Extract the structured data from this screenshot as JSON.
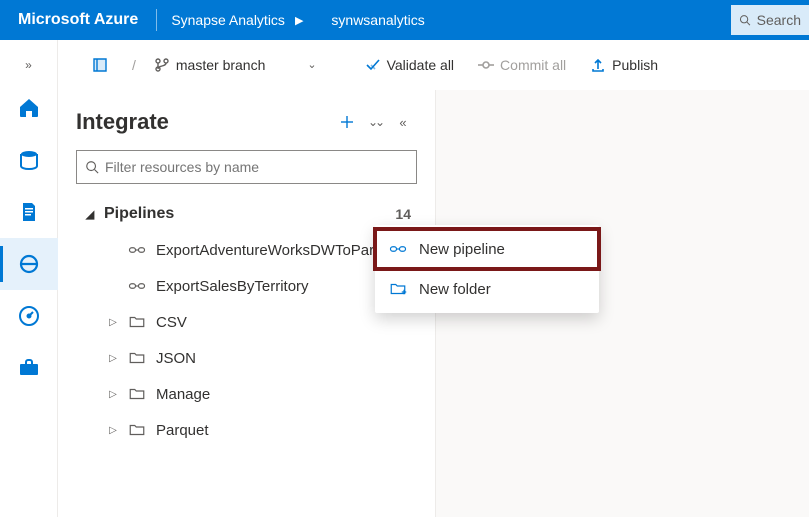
{
  "header": {
    "brand": "Microsoft Azure",
    "service": "Synapse Analytics",
    "workspace": "synwsanalytics",
    "search_placeholder": "Search"
  },
  "toolbar": {
    "branch": "master branch",
    "validate": "Validate all",
    "commit": "Commit all",
    "publish": "Publish"
  },
  "panel": {
    "title": "Integrate",
    "filter_placeholder": "Filter resources by name",
    "category": {
      "label": "Pipelines",
      "count": "14"
    },
    "items": [
      {
        "kind": "pipeline",
        "label": "ExportAdventureWorksDWToParquet"
      },
      {
        "kind": "pipeline",
        "label": "ExportSalesByTerritory"
      },
      {
        "kind": "folder",
        "label": "CSV"
      },
      {
        "kind": "folder",
        "label": "JSON"
      },
      {
        "kind": "folder",
        "label": "Manage"
      },
      {
        "kind": "folder",
        "label": "Parquet"
      }
    ]
  },
  "context_menu": {
    "new_pipeline": "New pipeline",
    "new_folder": "New folder"
  }
}
